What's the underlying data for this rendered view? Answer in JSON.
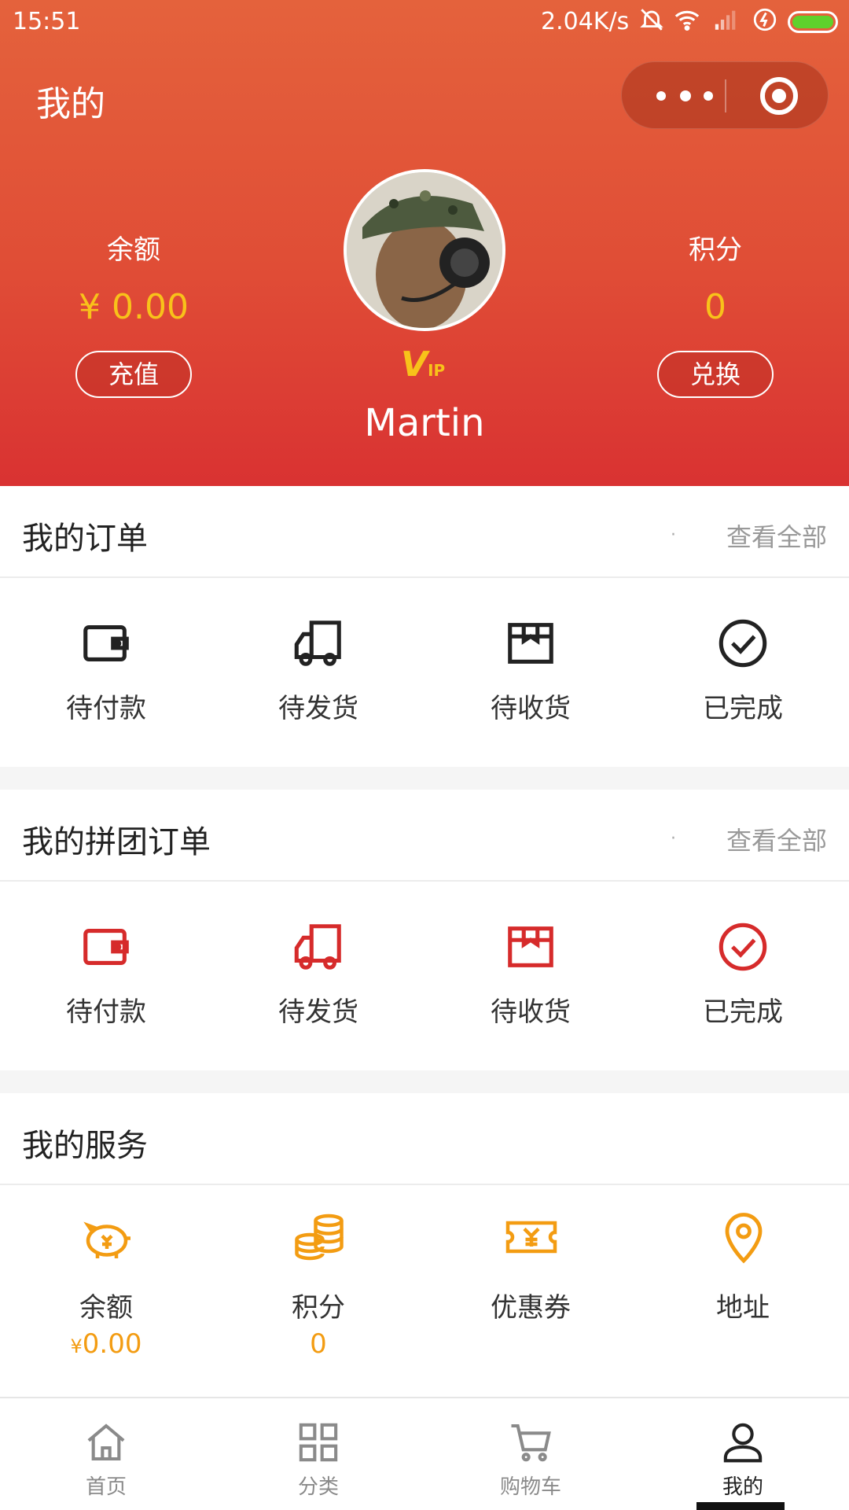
{
  "status_bar": {
    "time": "15:51",
    "net_speed": "2.04K/s"
  },
  "nav": {
    "title": "我的"
  },
  "profile": {
    "balance_label": "余额",
    "balance_value": "¥ 0.00",
    "recharge_label": "充值",
    "points_label": "积分",
    "points_value": "0",
    "exchange_label": "兑换",
    "vip_badge": "V",
    "vip_small": "IP",
    "username": "Martin"
  },
  "orders": {
    "title": "我的订单",
    "view_all": "查看全部",
    "items": [
      {
        "label": "待付款",
        "icon": "wallet-icon"
      },
      {
        "label": "待发货",
        "icon": "truck-icon"
      },
      {
        "label": "待收货",
        "icon": "box-icon"
      },
      {
        "label": "已完成",
        "icon": "check-circle-icon"
      }
    ]
  },
  "group_orders": {
    "title": "我的拼团订单",
    "view_all": "查看全部",
    "items": [
      {
        "label": "待付款",
        "icon": "wallet-icon"
      },
      {
        "label": "待发货",
        "icon": "truck-icon"
      },
      {
        "label": "待收货",
        "icon": "box-icon"
      },
      {
        "label": "已完成",
        "icon": "check-circle-icon"
      }
    ]
  },
  "services": {
    "title": "我的服务",
    "items": [
      {
        "label": "余额",
        "icon": "piggy-bank-icon",
        "value_symbol": "¥",
        "value": "0.00"
      },
      {
        "label": "积分",
        "icon": "coins-icon",
        "value": "0"
      },
      {
        "label": "优惠券",
        "icon": "coupon-icon"
      },
      {
        "label": "地址",
        "icon": "location-pin-icon"
      }
    ]
  },
  "tabbar": {
    "items": [
      {
        "label": "首页",
        "icon": "home-icon"
      },
      {
        "label": "分类",
        "icon": "grid-icon"
      },
      {
        "label": "购物车",
        "icon": "cart-icon"
      },
      {
        "label": "我的",
        "icon": "user-icon",
        "active": true
      }
    ]
  },
  "colors": {
    "header_top": "#e4623c",
    "header_bottom": "#d93232",
    "accent_gold": "#f8c21a",
    "group_red": "#d62b2b",
    "service_orange": "#f39c12"
  }
}
